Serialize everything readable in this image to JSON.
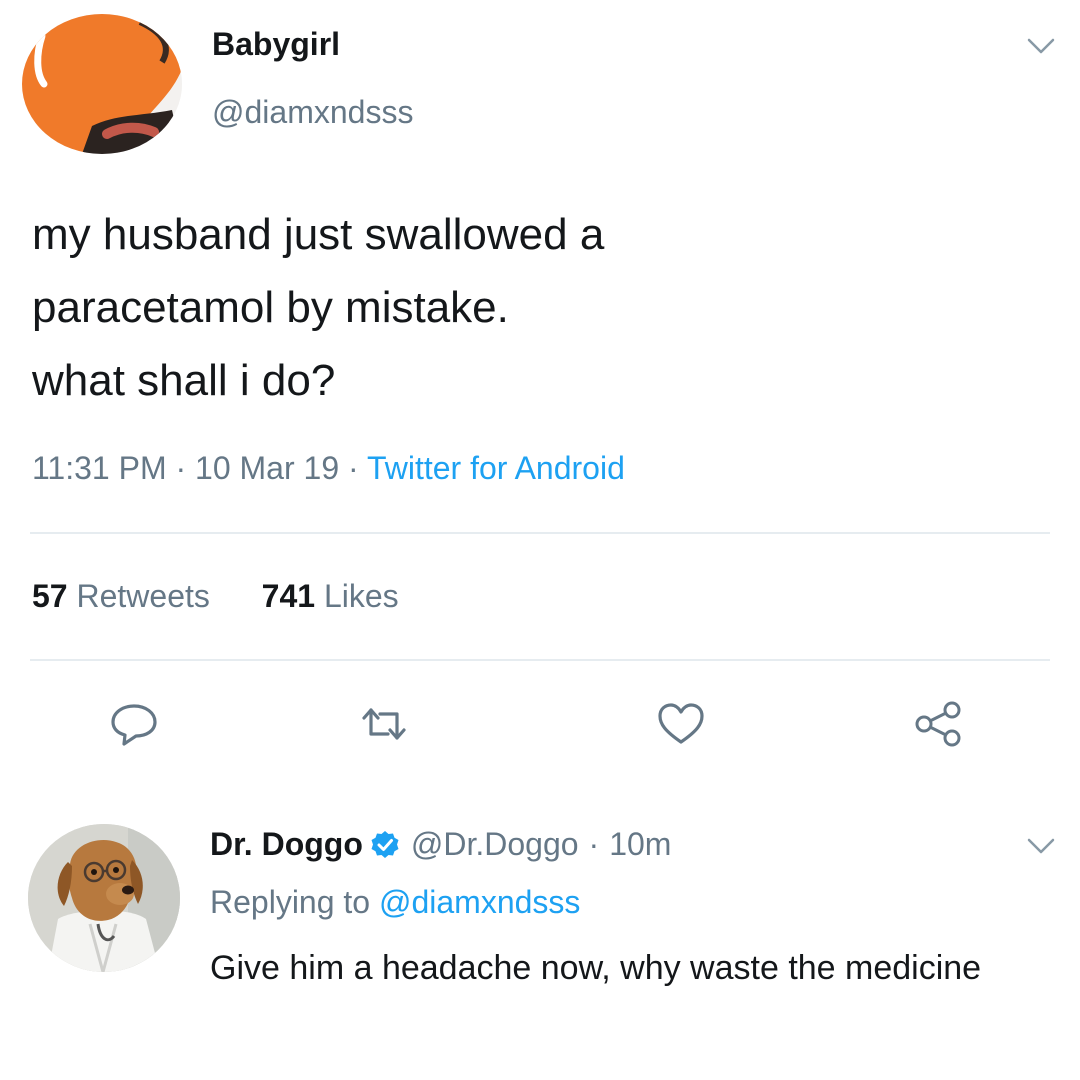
{
  "tweet": {
    "author": {
      "display_name": "Babygirl",
      "handle": "@diamxndsss",
      "avatar_icon": "avatar-orange-illustration"
    },
    "text": "my husband just swallowed a\nparacetamol by mistake.\nwhat shall i do?",
    "time": "11:31 PM",
    "date": "10 Mar 19",
    "separator": "·",
    "source": "Twitter for Android",
    "stats": {
      "retweets_count": "57",
      "retweets_label": "Retweets",
      "likes_count": "741",
      "likes_label": "Likes"
    },
    "actions": [
      {
        "name": "reply",
        "icon": "speech-bubble-icon"
      },
      {
        "name": "retweet",
        "icon": "retweet-arrows-icon"
      },
      {
        "name": "like",
        "icon": "heart-icon"
      },
      {
        "name": "share",
        "icon": "share-nodes-icon"
      }
    ]
  },
  "reply": {
    "author": {
      "display_name": "Dr. Doggo",
      "handle": "@Dr.Doggo",
      "verified": true,
      "avatar_icon": "avatar-dog-in-labcoat"
    },
    "separator": "·",
    "time_ago": "10m",
    "replying_to_label": "Replying to",
    "replying_to_handle": "@diamxndsss",
    "text": "Give him a headache now, why waste the medicine"
  },
  "colors": {
    "text_primary": "#14171a",
    "text_secondary": "#657786",
    "link": "#1da1f2",
    "divider": "#e6ecf0",
    "avatar_orange": "#f07a2a"
  }
}
